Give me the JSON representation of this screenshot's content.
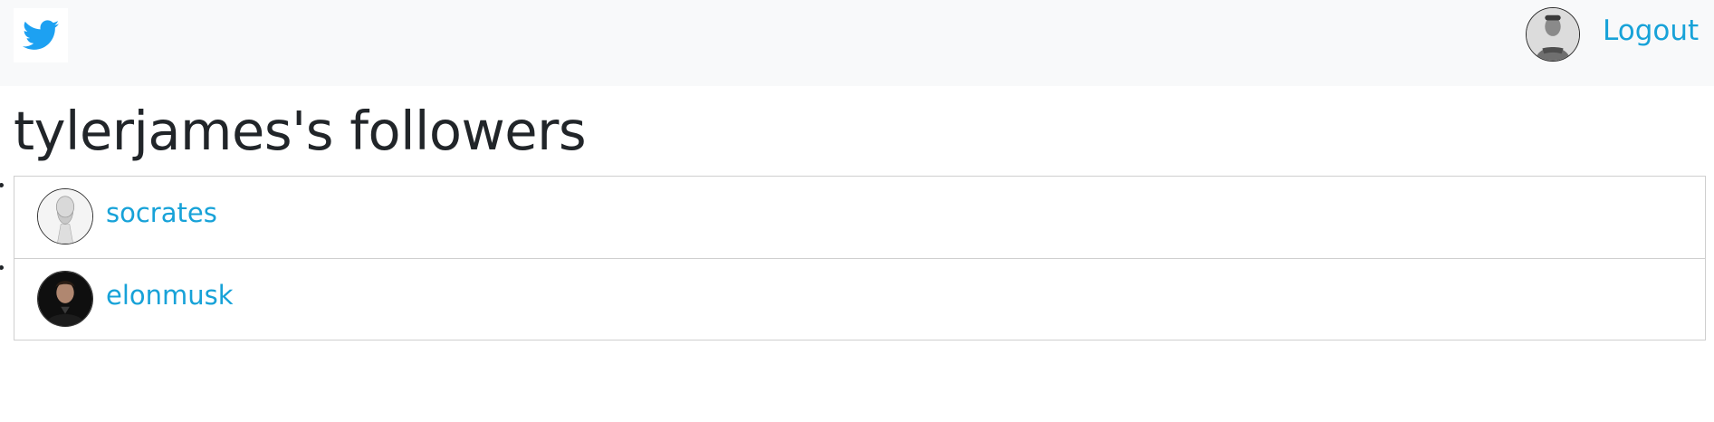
{
  "navbar": {
    "brand_icon": "twitter-bird-icon",
    "brand_color": "#1da1f2",
    "user_avatar": "user-avatar-photo",
    "logout_label": "Logout",
    "link_color": "#17a2d8",
    "background": "#f8f9fa"
  },
  "page": {
    "title": "tylerjames's followers"
  },
  "followers": [
    {
      "username": "socrates",
      "avatar": "socrates-bust-avatar"
    },
    {
      "username": "elonmusk",
      "avatar": "elonmusk-photo-avatar"
    }
  ]
}
